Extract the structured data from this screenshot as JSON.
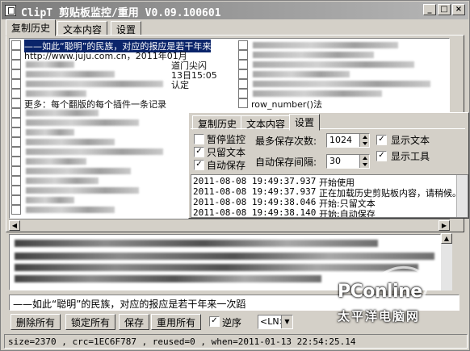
{
  "window": {
    "title": "ClipT 剪贴板监控/重用 V0.09.100601"
  },
  "main_tabs": [
    "复制历史",
    "文本内容",
    "设置"
  ],
  "history": {
    "left_items": [
      {
        "text": "——如此“聪明”的民族，对应的报应是若干年来",
        "selected": true
      },
      {
        "text": "http://www.juju.com.cn，2011年01月"
      },
      {
        "text": ""
      },
      {
        "text": ""
      },
      {
        "text": ""
      },
      {
        "text": ""
      },
      {
        "text": "更多：每个翻版的每个插件一条记录"
      },
      {
        "text": ""
      },
      {
        "text": ""
      },
      {
        "text": ""
      },
      {
        "text": ""
      },
      {
        "text": ""
      },
      {
        "text": ""
      },
      {
        "text": ""
      },
      {
        "text": ""
      },
      {
        "text": ""
      },
      {
        "text": ""
      },
      {
        "text": ""
      }
    ],
    "mid_items": [
      {
        "text": ""
      },
      {
        "text": "道门尖闪"
      },
      {
        "text": "13日15:05"
      },
      {
        "text": "认定"
      }
    ],
    "right_items": [
      {
        "text": ""
      },
      {
        "text": ""
      },
      {
        "text": ""
      },
      {
        "text": ""
      },
      {
        "text": ""
      },
      {
        "text": ""
      },
      {
        "text": "row_number()法"
      }
    ]
  },
  "settings_popup": {
    "tabs": [
      "复制历史",
      "文本内容",
      "设置"
    ],
    "active_tab": "设置",
    "pause_monitor": {
      "label": "暂停监控",
      "checked": false
    },
    "text_only": {
      "label": "只留文本",
      "checked": true
    },
    "auto_save": {
      "label": "自动保存",
      "checked": true
    },
    "max_saves": {
      "label": "最多保存次数:",
      "value": "1024"
    },
    "auto_interval": {
      "label": "自动保存间隔:",
      "value": "30"
    },
    "show_text": {
      "label": "显示文本",
      "checked": true
    },
    "show_tools": {
      "label": "显示工具",
      "checked": true
    },
    "log": [
      {
        "time": "2011-08-08 19:49:37.937",
        "message": "开始使用"
      },
      {
        "time": "2011-08-08 19:49:37.937",
        "message": "正在加载历史剪贴板内容，请稍候。"
      },
      {
        "time": "2011-08-08 19:49:38.046",
        "message": "开始:只留文本"
      },
      {
        "time": "2011-08-08 19:49:38.140",
        "message": "开始:自动保存"
      }
    ]
  },
  "current_clip": "——如此“聪明”的民族，对应的报应是若干年来一次蹈",
  "toolbar": {
    "delete_all": "删除所有",
    "lock_all": "锁定所有",
    "save": "保存",
    "reuse_all": "重用所有",
    "reverse_label": "逆序",
    "reverse_checked": true,
    "separator_value": "<LN>"
  },
  "status": "size=2370 , crc=1EC6F787 , reused=0 , when=2011-01-13 22:54:25.14",
  "watermark": {
    "brand": "PConline",
    "subtitle": "太平洋电脑网"
  },
  "colors": {
    "selection": "#0a246a",
    "face": "#d4d0c8"
  }
}
